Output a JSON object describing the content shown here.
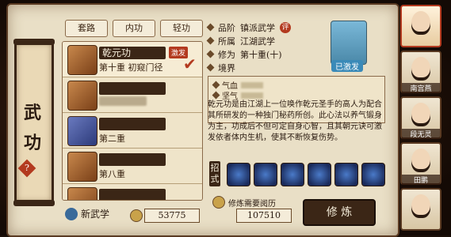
{
  "panel": {
    "title_line1": "武",
    "title_line2": "功",
    "help_badge": "?"
  },
  "tabs": [
    "套路",
    "内功",
    "轻功"
  ],
  "list": [
    {
      "name": "乾元功",
      "level": "第十重",
      "progress_text": "初窥门径",
      "badge": "激发",
      "selected": true
    },
    {
      "name": "",
      "level": "",
      "progress_text": "",
      "badge": "",
      "selected": false
    },
    {
      "name": "",
      "level": "第二重",
      "progress_text": "",
      "badge": "",
      "selected": false
    },
    {
      "name": "",
      "level": "第八重",
      "progress_text": "",
      "badge": "",
      "selected": false
    },
    {
      "name": "",
      "level": "",
      "progress_text": "",
      "badge": "",
      "selected": false
    }
  ],
  "footer": {
    "new_skill_label": "新武学",
    "amount1": "53775",
    "amount2": "107510"
  },
  "info": {
    "quality_label": "品阶",
    "quality_value": "镇派武学",
    "quality_badge": "评",
    "faction_label": "所属",
    "faction_value": "江湖武学",
    "cultivation_label": "修为",
    "cultivation_value": "第十重(十)",
    "realm_label": "境界",
    "portrait_tag": "已激发"
  },
  "stats": {
    "qixue_label": "气血",
    "jianqi_label": "坚气"
  },
  "description": "乾元功是由江湖上一位唤作乾元圣手的高人为配合其所研发的一种独门秘药所创。此心法以养气锻身为主，功成后不但可定自身心智，且其朝元诀可激发依者体内生机，使其不断恢复伤势。",
  "moves_label": "招式",
  "train": {
    "requirement": "修炼需要阅历",
    "button": "修  炼"
  },
  "characters": [
    {
      "name": "",
      "selected": true
    },
    {
      "name": "南宫燕",
      "selected": false
    },
    {
      "name": "段无灵",
      "selected": false
    },
    {
      "name": "田鹏",
      "selected": false
    },
    {
      "name": "",
      "selected": false
    }
  ]
}
